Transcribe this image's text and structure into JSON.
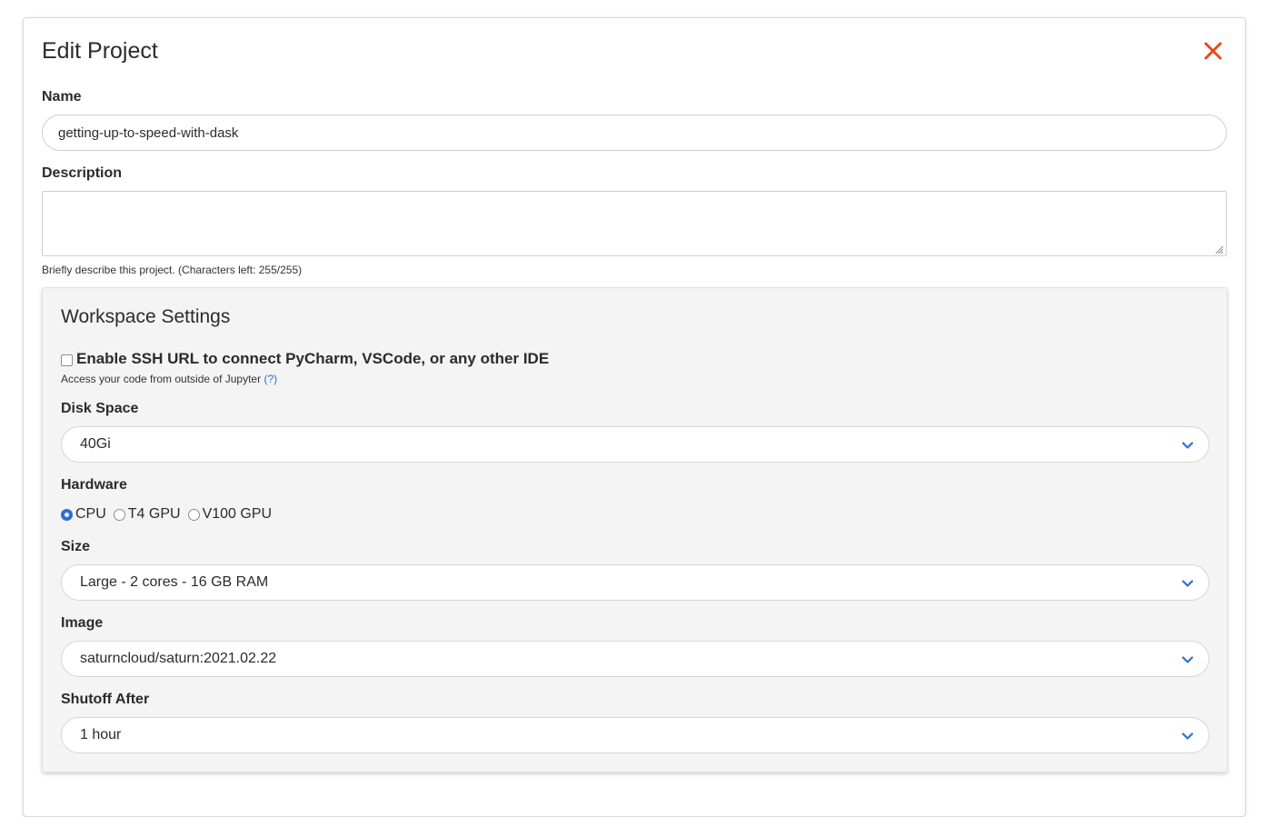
{
  "modal": {
    "title": "Edit Project",
    "close_icon": "close-icon",
    "accent_color": "#e8491d"
  },
  "name_field": {
    "label": "Name",
    "value": "getting-up-to-speed-with-dask"
  },
  "description_field": {
    "label": "Description",
    "value": "",
    "helper": "Briefly describe this project. (Characters left: 255/255)"
  },
  "workspace": {
    "title": "Workspace Settings",
    "ssh": {
      "label": "Enable SSH URL to connect PyCharm, VSCode, or any other IDE",
      "checked": false,
      "help_text": "Access your code from outside of Jupyter",
      "help_link": "(?)"
    },
    "disk_space": {
      "label": "Disk Space",
      "value": "40Gi"
    },
    "hardware": {
      "label": "Hardware",
      "options": [
        "CPU",
        "T4 GPU",
        "V100 GPU"
      ],
      "selected": "CPU"
    },
    "size": {
      "label": "Size",
      "value": "Large - 2 cores - 16 GB RAM"
    },
    "image": {
      "label": "Image",
      "value": "saturncloud/saturn:2021.02.22"
    },
    "shutoff": {
      "label": "Shutoff After",
      "value": "1 hour"
    }
  },
  "colors": {
    "link_blue": "#2b6fd6",
    "close_orange": "#e8491d"
  }
}
